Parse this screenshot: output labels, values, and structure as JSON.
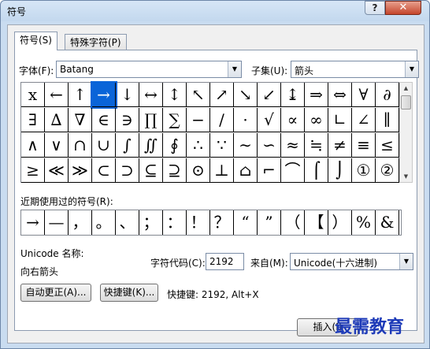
{
  "window": {
    "title": "符号",
    "help_label": "?",
    "close_label": "✕"
  },
  "tabs": [
    {
      "label": "符号(S)"
    },
    {
      "label": "特殊字符(P)"
    }
  ],
  "font": {
    "label": "字体(F):",
    "value": "Batang"
  },
  "subset": {
    "label": "子集(U):",
    "value": "箭头"
  },
  "symbols": [
    [
      "x",
      "←",
      "↑",
      "→",
      "↓",
      "↔",
      "↕",
      "↖",
      "↗",
      "↘",
      "↙",
      "↨",
      "⇒",
      "⇔",
      "∀",
      "∂"
    ],
    [
      "∃",
      "∆",
      "∇",
      "∈",
      "∋",
      "∏",
      "∑",
      "−",
      "∕",
      "·",
      "√",
      "∝",
      "∞",
      "∟",
      "∠",
      "∥"
    ],
    [
      "∧",
      "∨",
      "∩",
      "∪",
      "∫",
      "∬",
      "∮",
      "∴",
      "∵",
      "∼",
      "∽",
      "≈",
      "≒",
      "≠",
      "≡",
      "≤"
    ],
    [
      "≥",
      "≪",
      "≫",
      "⊂",
      "⊃",
      "⊆",
      "⊇",
      "⊙",
      "⊥",
      "⌂",
      "⌐",
      "⌒",
      "⌠",
      "⌡",
      "①",
      "②"
    ]
  ],
  "selected_symbol": {
    "row": 0,
    "col": 3
  },
  "recent": {
    "label": "近期使用过的符号(R):",
    "symbols": [
      "→",
      "—",
      "，",
      "。",
      "、",
      "；",
      "：",
      "！",
      "？",
      "“",
      "”",
      "（",
      "【",
      "）",
      "%",
      "&"
    ]
  },
  "unicode_name": {
    "label": "Unicode 名称:",
    "value": "向右箭头"
  },
  "char_code": {
    "label": "字符代码(C):",
    "value": "2192"
  },
  "from": {
    "label": "来自(M):",
    "value": "Unicode(十六进制)"
  },
  "buttons": {
    "autocorrect": "自动更正(A)...",
    "shortcut_key": "快捷键(K)...",
    "insert": "插入(I)"
  },
  "shortcut_text": "快捷键: 2192, Alt+X",
  "watermark": "最需教育",
  "colors": {
    "selection": "#0a64d8",
    "title_bar": "#c9dcf0",
    "close_button": "#c5462c"
  }
}
